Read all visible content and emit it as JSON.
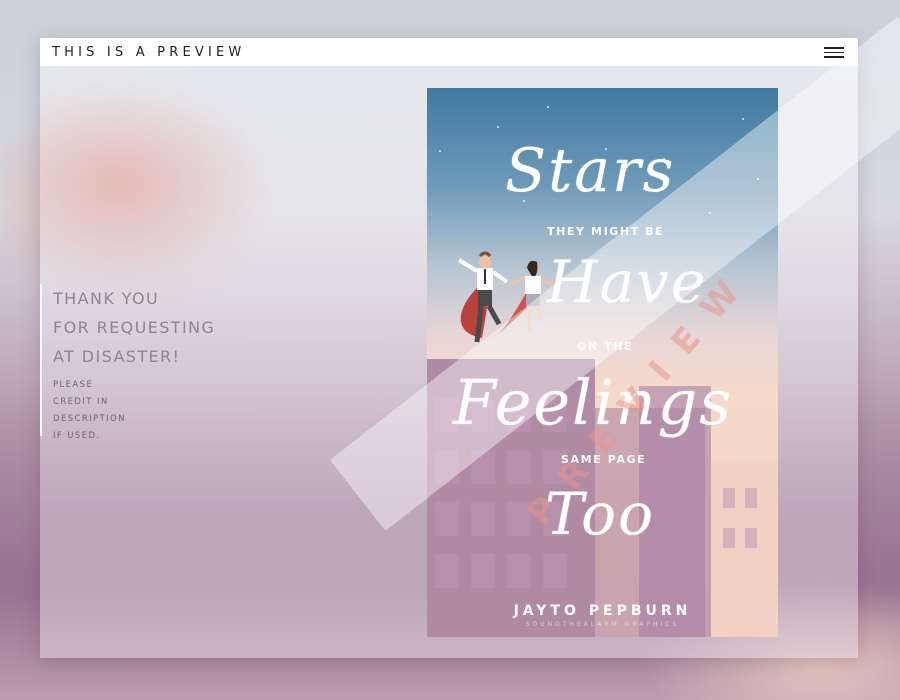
{
  "header": {
    "title": "THIS IS A PREVIEW",
    "menu_icon": "hamburger-menu-icon"
  },
  "message": {
    "lines": [
      "THANK YOU",
      "FOR REQUESTING",
      "AT DISASTER!"
    ],
    "small_lines": [
      "PLEASE",
      "CREDIT IN",
      "DESCRIPTION",
      "IF USED."
    ]
  },
  "cover": {
    "title_words": [
      "Stars",
      "Have",
      "Feelings",
      "Too"
    ],
    "subtitles": [
      "THEY MIGHT BE",
      "ON THE",
      "SAME PAGE"
    ],
    "author": "JAYTO PEPBURN",
    "credit": "SOUNDTHEALARM GRAPHICS"
  },
  "watermark": {
    "text": "PREVIEW"
  },
  "colors": {
    "sky_top": "#3f7aa0",
    "sky_bottom": "#f3d2c2",
    "building": "#96709a",
    "accent_text": "#8b8590"
  }
}
